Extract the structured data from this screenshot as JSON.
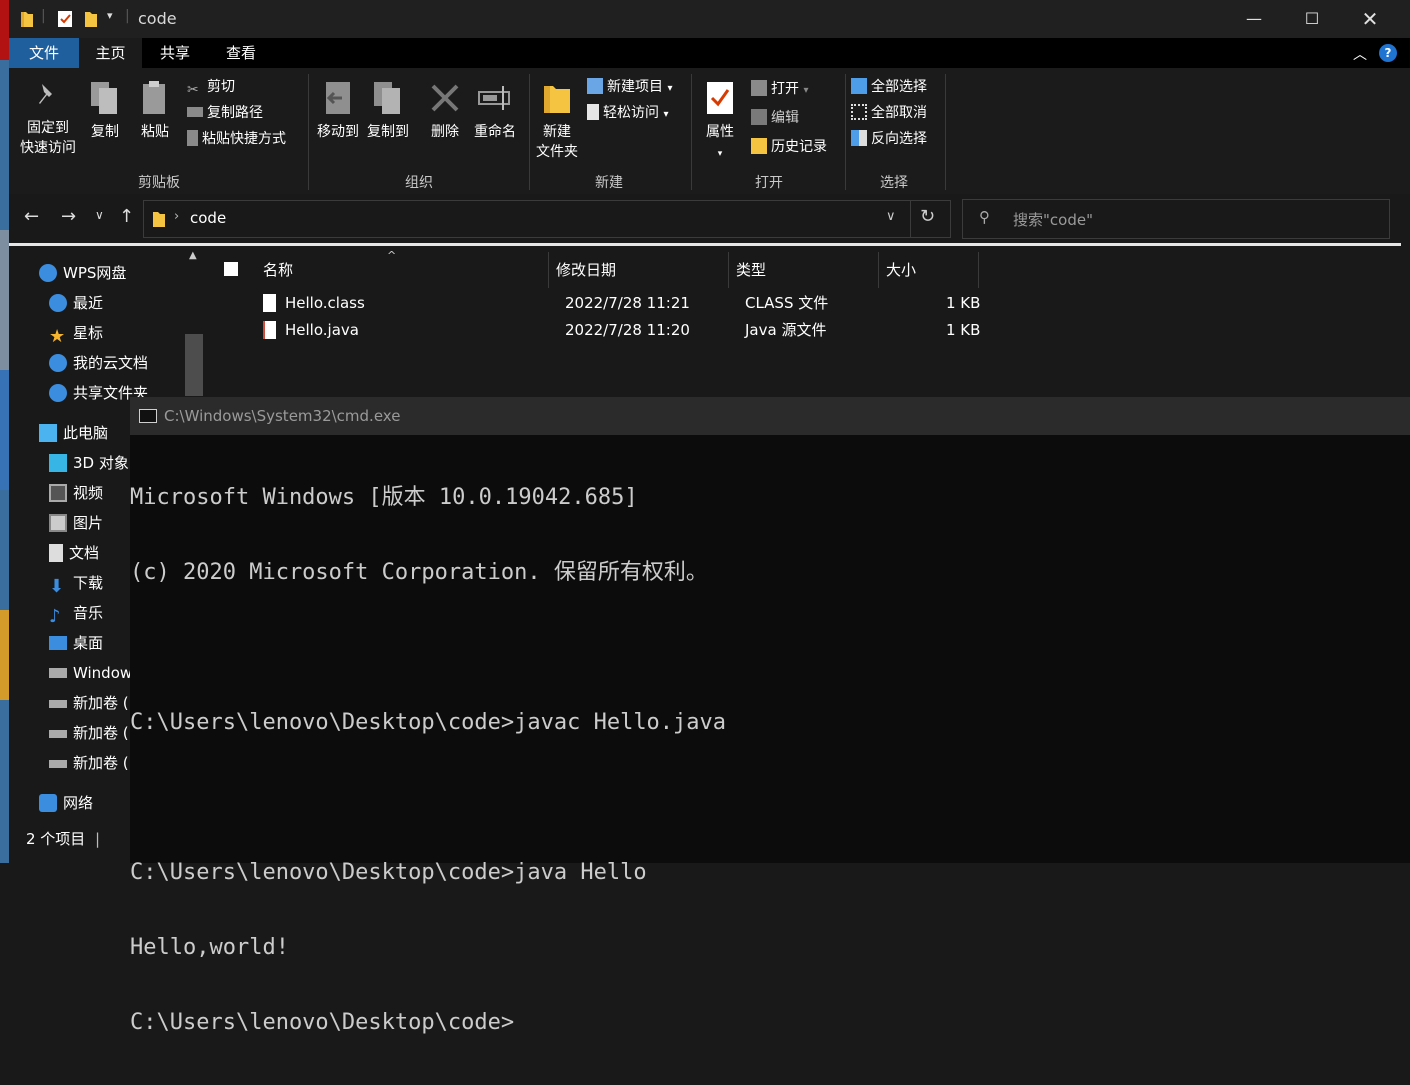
{
  "window": {
    "title": "code"
  },
  "ribbon_tabs": [
    "文件",
    "主页",
    "共享",
    "查看"
  ],
  "ribbon": {
    "clipboard": {
      "label": "剪贴板",
      "pin_line1": "固定到",
      "pin_line2": "快速访问",
      "copy": "复制",
      "paste": "粘贴",
      "cut": "剪切",
      "copy_path": "复制路径",
      "paste_shortcut": "粘贴快捷方式"
    },
    "organize": {
      "label": "组织",
      "move_to": "移动到",
      "copy_to": "复制到",
      "delete": "删除",
      "rename": "重命名"
    },
    "new": {
      "label": "新建",
      "new_folder_line1": "新建",
      "new_folder_line2": "文件夹",
      "new_item": "新建项目",
      "easy_access": "轻松访问"
    },
    "open": {
      "label": "打开",
      "properties": "属性",
      "open": "打开",
      "edit": "编辑",
      "history": "历史记录"
    },
    "select": {
      "label": "选择",
      "select_all": "全部选择",
      "select_none": "全部取消",
      "invert": "反向选择"
    }
  },
  "address": {
    "path": "code",
    "search_placeholder": "搜索\"code\""
  },
  "nav_pane": [
    {
      "label": "WPS网盘",
      "icon": "cloud-icon"
    },
    {
      "label": "最近",
      "icon": "clock-icon"
    },
    {
      "label": "星标",
      "icon": "star-icon"
    },
    {
      "label": "我的云文档",
      "icon": "cloud-doc-icon"
    },
    {
      "label": "共享文件夹",
      "icon": "share-icon"
    },
    {
      "label": "此电脑",
      "icon": "computer-icon"
    },
    {
      "label": "3D 对象",
      "icon": "cube-icon"
    },
    {
      "label": "视频",
      "icon": "video-icon"
    },
    {
      "label": "图片",
      "icon": "picture-icon"
    },
    {
      "label": "文档",
      "icon": "document-icon"
    },
    {
      "label": "下载",
      "icon": "download-icon"
    },
    {
      "label": "音乐",
      "icon": "music-icon"
    },
    {
      "label": "桌面",
      "icon": "desktop-icon"
    },
    {
      "label": "Windows (C:)",
      "icon": "drive-c-icon"
    },
    {
      "label": "新加卷 (D:)",
      "icon": "drive-icon"
    },
    {
      "label": "新加卷 (E:)",
      "icon": "drive-icon"
    },
    {
      "label": "新加卷 (F:)",
      "icon": "drive-icon"
    },
    {
      "label": "网络",
      "icon": "network-icon"
    }
  ],
  "file_list": {
    "columns": [
      "名称",
      "修改日期",
      "类型",
      "大小"
    ],
    "rows": [
      {
        "name": "Hello.class",
        "date": "2022/7/28 11:21",
        "type": "CLASS 文件",
        "size": "1 KB"
      },
      {
        "name": "Hello.java",
        "date": "2022/7/28 11:20",
        "type": "Java 源文件",
        "size": "1 KB"
      }
    ]
  },
  "status": {
    "count": "2 个项目"
  },
  "cmd": {
    "title": "C:\\Windows\\System32\\cmd.exe",
    "lines": [
      "Microsoft Windows [版本 10.0.19042.685]",
      "(c) 2020 Microsoft Corporation. 保留所有权利。",
      "",
      "C:\\Users\\lenovo\\Desktop\\code>javac Hello.java",
      "",
      "C:\\Users\\lenovo\\Desktop\\code>java Hello",
      "Hello,world!",
      "C:\\Users\\lenovo\\Desktop\\code>"
    ]
  },
  "colors": {
    "accent": "#1f5f9e",
    "background": "#191919",
    "cmd_bg": "#0c0c0c",
    "cmd_text": "#cccccc"
  }
}
